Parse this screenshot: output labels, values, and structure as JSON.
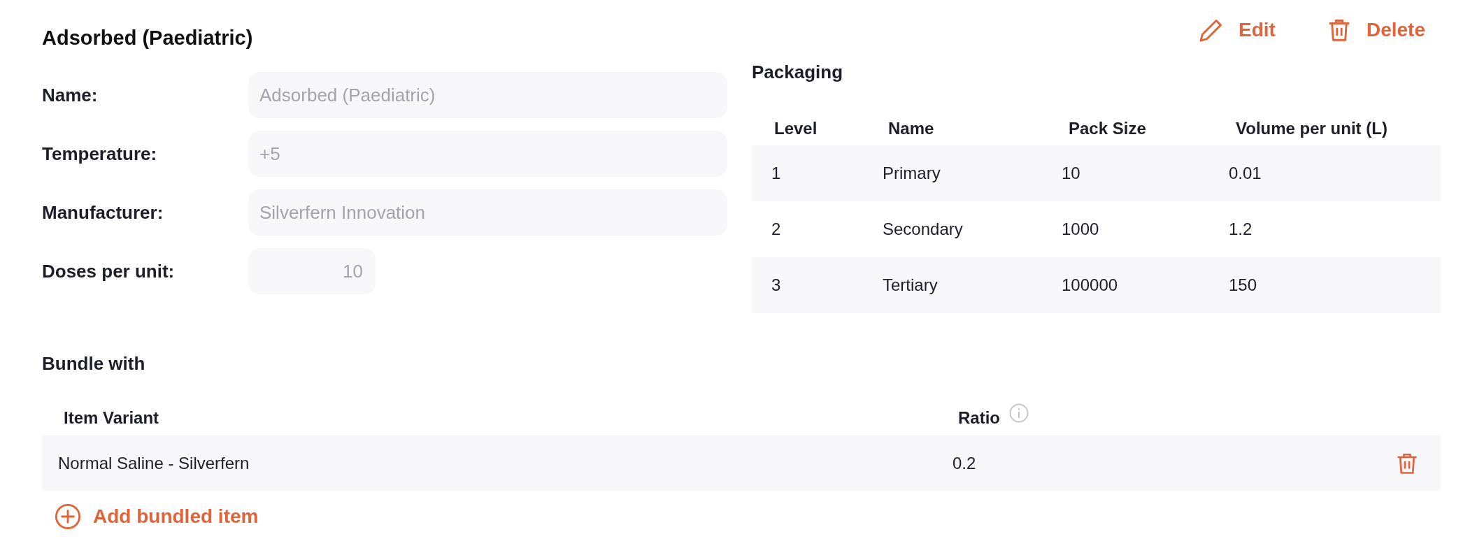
{
  "title": "Adsorbed (Paediatric)",
  "actions": [
    {
      "label": "Edit",
      "kind": "edit"
    },
    {
      "label": "Delete",
      "kind": "delete"
    }
  ],
  "fields": [
    {
      "label": "Name:",
      "value": "Adsorbed (Paediatric)",
      "kind": "text",
      "disabled": true
    },
    {
      "label": "Temperature:",
      "value": "+5",
      "kind": "text",
      "disabled": true
    },
    {
      "label": "Manufacturer:",
      "value": "Silverfern Innovation",
      "kind": "text",
      "disabled": true
    },
    {
      "label": "Doses per unit:",
      "value": "10",
      "kind": "number",
      "disabled": true
    }
  ],
  "packaging": {
    "title": "Packaging",
    "columns": [
      "Level",
      "Name",
      "Pack Size",
      "Volume per unit (L)"
    ],
    "rows": [
      [
        "1",
        "Primary",
        "10",
        "0.01"
      ],
      [
        "2",
        "Secondary",
        "1000",
        "1.2"
      ],
      [
        "3",
        "Tertiary",
        "100000",
        "150"
      ]
    ]
  },
  "bundle": {
    "title": "Bundle with",
    "columns": [
      "Item Variant",
      "Ratio"
    ],
    "rows": [
      {
        "item_variant": "Normal Saline - Silverfern",
        "ratio": "0.2"
      }
    ],
    "add_label": "Add bundled item"
  }
}
